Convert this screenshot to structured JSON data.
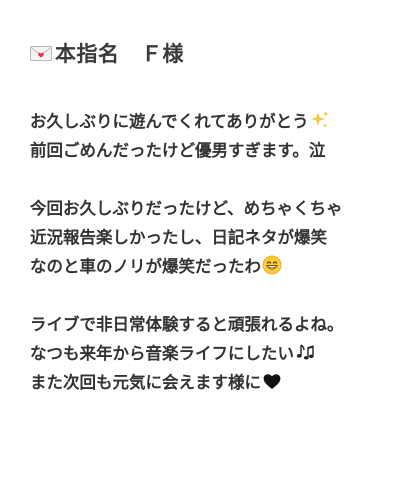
{
  "post": {
    "title_icon": "love-letter-icon",
    "title": "本指名　Ｆ様",
    "paragraphs": [
      {
        "lines": [
          {
            "text": "お久しぶりに遊んでくれてありがとう",
            "emoji": "sparkles-icon"
          },
          {
            "text": "前回ごめんだったけど優男すぎます。泣",
            "emoji": ""
          }
        ]
      },
      {
        "lines": [
          {
            "text": "今回お久しぶりだったけど、めちゃくちゃ",
            "emoji": ""
          },
          {
            "text": "近況報告楽しかったし、日記ネタが爆笑",
            "emoji": ""
          },
          {
            "text": "なのと車のノリが爆笑だったわ",
            "emoji": "grinning-face-icon"
          }
        ]
      },
      {
        "lines": [
          {
            "text": "ライブで非日常体験すると頑張れるよね。",
            "emoji": ""
          },
          {
            "text": "なつも来年から音楽ライフにしたい",
            "emoji": "music-notes-icon"
          },
          {
            "text": "また次回も元気に会えます様に",
            "emoji": "black-heart-icon"
          }
        ]
      }
    ]
  },
  "colors": {
    "text": "#333333",
    "background": "#ffffff"
  }
}
